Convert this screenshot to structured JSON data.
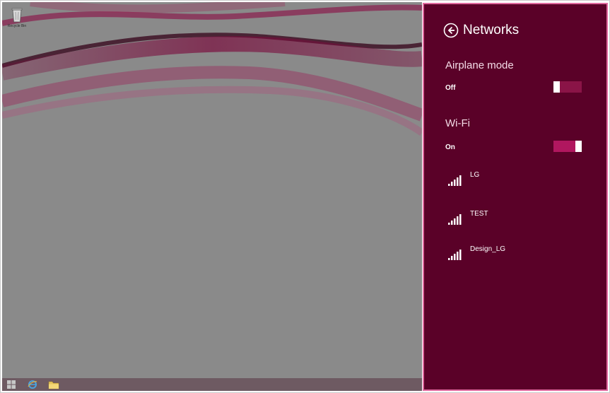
{
  "desktop": {
    "recycle_bin_label": "Recycle Bin",
    "wallpaper_accent": "#7a0a3c",
    "taskbar": {
      "items": [
        "start-button",
        "internet-explorer",
        "file-explorer"
      ]
    }
  },
  "charm": {
    "title": "Networks",
    "background": "#5a0128",
    "airplane_mode": {
      "label": "Airplane mode",
      "state": "Off",
      "on": false
    },
    "wifi": {
      "label": "Wi-Fi",
      "state": "On",
      "on": true
    },
    "networks": [
      {
        "name": "LG",
        "icon": "wifi-signal-icon"
      },
      {
        "name": "TEST",
        "icon": "wifi-signal-icon"
      },
      {
        "name": "Design_LG",
        "icon": "wifi-signal-icon"
      }
    ]
  }
}
